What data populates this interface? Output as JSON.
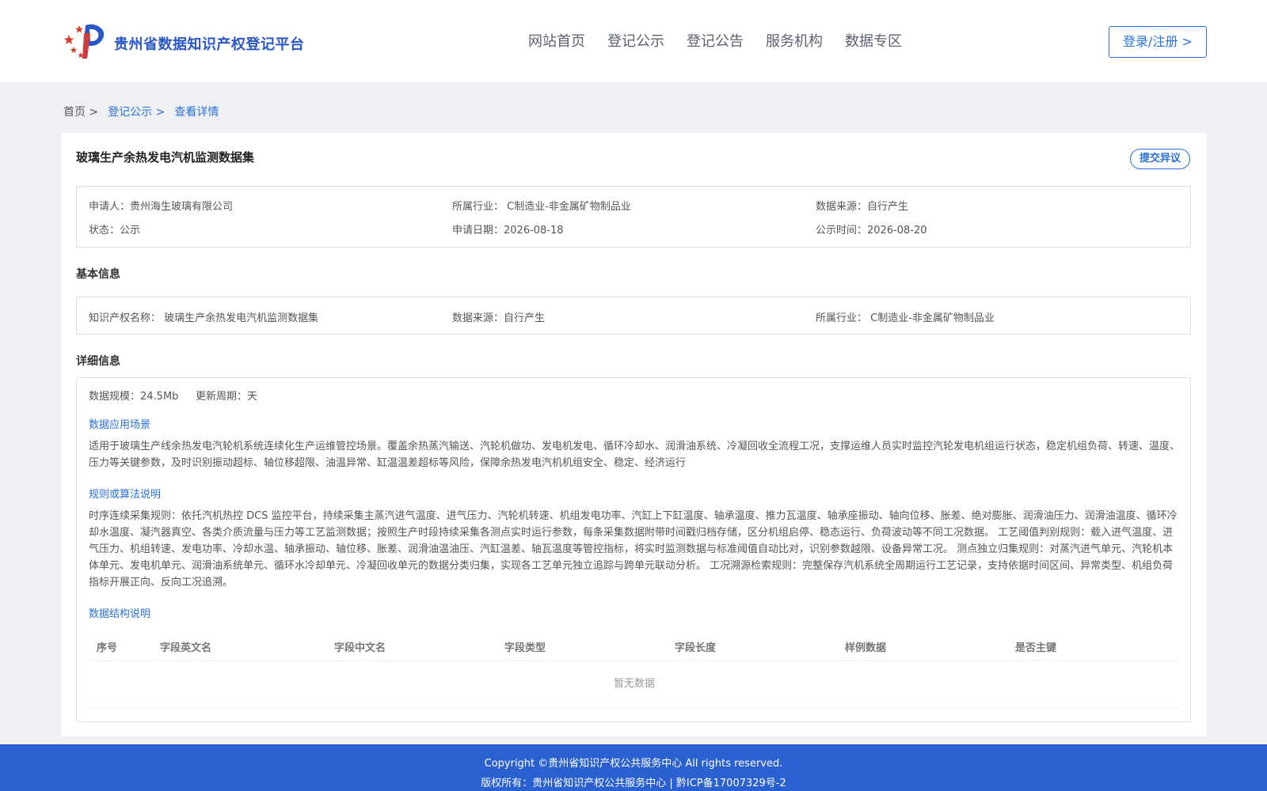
{
  "header": {
    "site_title": "贵州省数据知识产权登记平台",
    "nav": [
      "网站首页",
      "登记公示",
      "登记公告",
      "服务机构",
      "数据专区"
    ],
    "login_label": "登录/注册 >"
  },
  "breadcrumb": {
    "home": "首页 >",
    "section": "登记公示 >",
    "current": "查看详情"
  },
  "dataset": {
    "title": "玻璃生产余热发电汽机监测数据集",
    "objection_label": "提交异议",
    "summary": {
      "applicant": "申请人：贵州海生玻璃有限公司",
      "industry": "所属行业： C制造业-非金属矿物制品业",
      "source": "数据来源：自行产生",
      "status": "状态：公示",
      "apply_date": "申请日期：2026-08-18",
      "publish_time": "公示时间：2026-08-20"
    }
  },
  "basic_info": {
    "title": "基本信息",
    "ip_name": "知识产权名称： 玻璃生产余热发电汽机监测数据集",
    "source": "数据来源：自行产生",
    "industry": "所属行业： C制造业-非金属矿物制品业"
  },
  "detail_info": {
    "title": "详细信息",
    "scale": "数据规模：24.5Mb",
    "cycle": "更新周期：天",
    "scenario_title": "数据应用场景",
    "scenario_text": "适用于玻璃生产线余热发电汽轮机系统连续化生产运维管控场景。覆盖余热蒸汽输送、汽轮机做功、发电机发电、循环冷却水、润滑油系统、冷凝回收全流程工况，支撑运维人员实时监控汽轮发电机组运行状态，稳定机组负荷、转速、温度、压力等关键参数，及时识别振动超标、轴位移超限、油温异常、缸温温差超标等风险，保障余热发电汽机机组安全、稳定、经济运行",
    "rules_title": "规则或算法说明",
    "rules_text": "时序连续采集规则：依托汽机热控 DCS 监控平台，持续采集主蒸汽进气温度、进气压力、汽轮机转速、机组发电功率、汽缸上下缸温度、轴承温度、推力瓦温度、轴承座振动、轴向位移、胀差、绝对膨胀、润滑油压力、润滑油温度、循环冷却水温度、凝汽器真空、各类介质流量与压力等工艺监测数据；按照生产时段持续采集各测点实时运行参数，每条采集数据附带时间戳归档存储，区分机组启停、稳态运行、负荷波动等不同工况数据。 工艺阈值判别规则：载入进气温度、进气压力、机组转速、发电功率、冷却水温、轴承振动、轴位移、胀差、润滑油温油压、汽缸温差、轴瓦温度等管控指标，将实时监测数据与标准阈值自动比对，识别参数越限、设备异常工况。 测点独立归集规则：对蒸汽进气单元、汽轮机本体单元、发电机单元、润滑油系统单元、循环水冷却单元、冷凝回收单元的数据分类归集，实现各工艺单元独立追踪与跨单元联动分析。 工况溯源检索规则：完整保存汽机系统全周期运行工艺记录，支持依据时间区间、异常类型、机组负荷指标开展正向、反向工况追溯。",
    "structure_title": "数据结构说明",
    "table_headers": [
      "序号",
      "字段英文名",
      "字段中文名",
      "字段类型",
      "字段长度",
      "样例数据",
      "是否主键"
    ],
    "table_empty": "暂无数据"
  },
  "footer": {
    "copyright": "Copyright ©贵州省知识产权公共服务中心 All rights reserved.",
    "rights": "版权所有：贵州省知识产权公共服务中心 | 黔ICP备17007329号-2"
  },
  "colors": {
    "brand_blue": "#2a57c7",
    "link_blue": "#2a6fdb",
    "footer_blue": "#2a60d0",
    "logo_red": "#e03a2b"
  }
}
